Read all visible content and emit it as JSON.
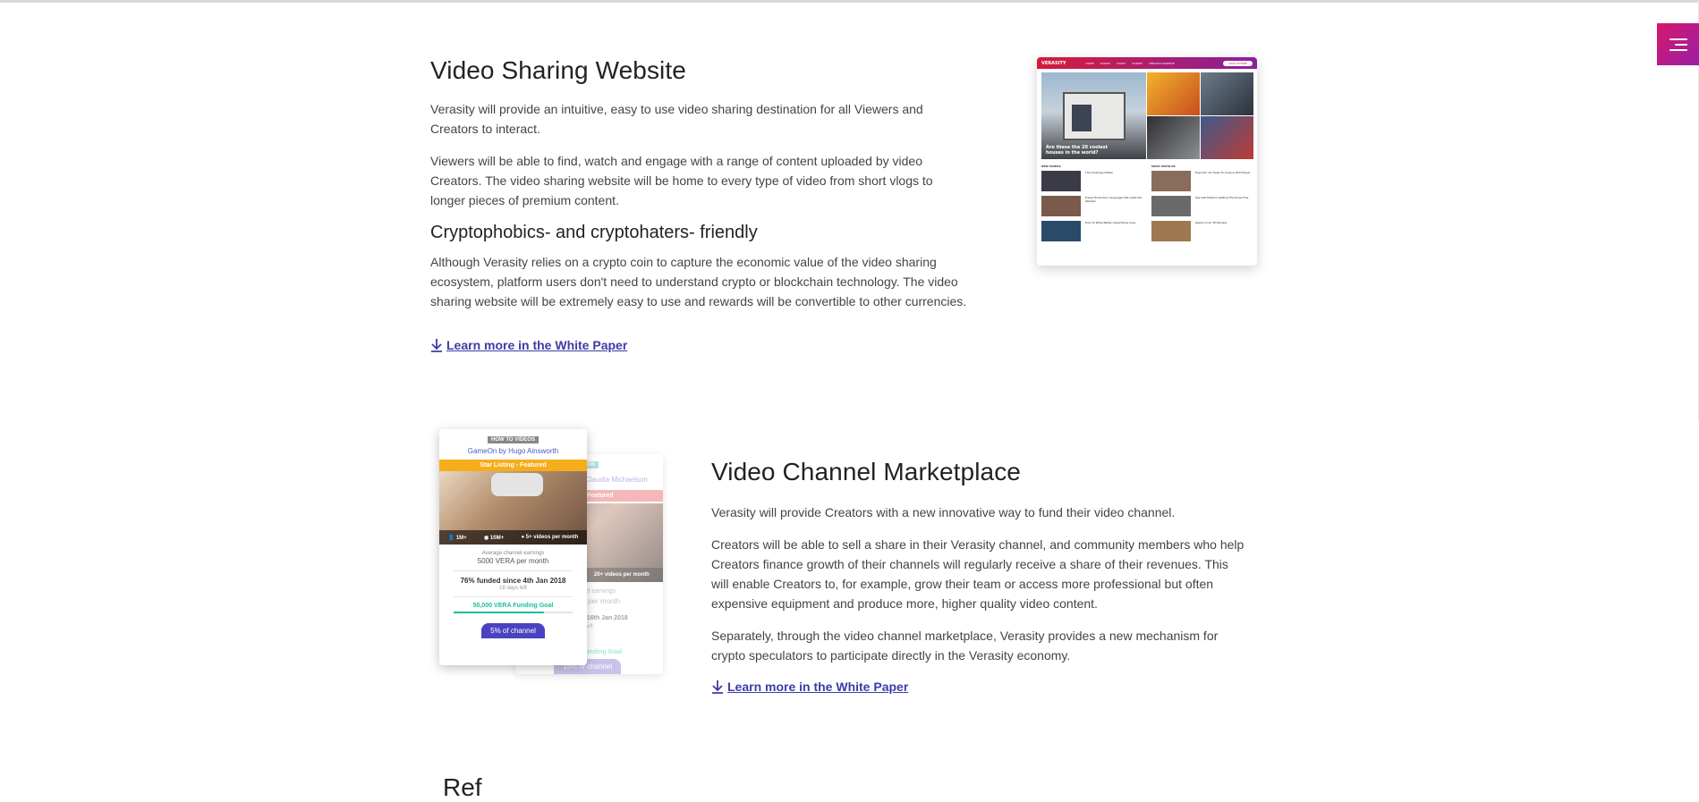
{
  "section1": {
    "title": "Video Sharing Website",
    "p1": "Verasity will provide an intuitive, easy to use video sharing destination for all Viewers and Creators to interact.",
    "p2": "Viewers will be able to find, watch and engage with a range of content uploaded by video Creators. The video sharing website will be home to every type of video from short vlogs to longer pieces of premium content.",
    "subtitle": "Cryptophobics- and cryptohaters- friendly",
    "p3": "Although Verasity relies on a crypto coin to capture the economic value of the video sharing ecosystem, platform users don't need to understand crypto or blockchain technology. The video sharing website will be extremely easy to use and rewards will be convertible to other currencies.",
    "link": "Learn more in the White Paper"
  },
  "section2": {
    "title": "Video Channel Marketplace",
    "p1": "Verasity will provide Creators with a new innovative way to fund their video channel.",
    "p2": "Creators will be able to sell a share in their Verasity channel, and community members who help Creators finance growth of their channels will regularly receive a share of their revenues. This will enable Creators to, for example, grow their team or access more professional but often expensive equipment and produce more, higher quality video content.",
    "p3": "Separately, through the video channel marketplace, Verasity provides a new mechanism for crypto speculators to participate directly in the Verasity economy.",
    "link": "Learn more in the White Paper"
  },
  "site_mock": {
    "logo": "VERASITY",
    "nav": [
      "HOME",
      "SHOWS",
      "CHART",
      "STORES",
      "VERASITY.ADSERVE"
    ],
    "signup": "SIGN UP FREE",
    "hero_caption": "Are these the 20 coolest houses in the world?",
    "col1_header": "NEW VIDEOS",
    "col2_header": "MOST POPULAR",
    "col1_items": [
      "The Amazing Hidden",
      "Travel Production Language that Lasts the Wanted",
      "How To Write Better Advertising Copy"
    ],
    "col2_items": [
      "Hypnotic 10 Views To Acquire Wild Power",
      "Sea Salt Eastern Getting The Kinsa Fine",
      "Apple Iconic 3D Review"
    ]
  },
  "phone_front": {
    "tag": "HOW TO VIDEOS",
    "creator": "GameOn by Hugo Ainsworth",
    "band": "Star Listing - Featured",
    "stats": [
      "1M+",
      "10M+",
      "5+ videos per month"
    ],
    "earn_label": "Average channel earnings",
    "earn_value": "5000 VERA per month",
    "funded": "76% funded since 4th Jan 2018",
    "days_left": "18 days left",
    "goal": "50,000 VERA Funding Goal",
    "goal_progress": 0.76,
    "pill": "5% of channel"
  },
  "phone_back": {
    "tag": "ION",
    "creator": "Claudia Michaelson",
    "band": "Featured",
    "stats": "20+ videos per month",
    "earn_label": "nel earnings",
    "earn_value": "A per month",
    "funded": "e 16th Jan 2018",
    "days_left": "s left",
    "goal": "Funding Goal",
    "pill": "15% of channel"
  },
  "peek_text": "Ref"
}
